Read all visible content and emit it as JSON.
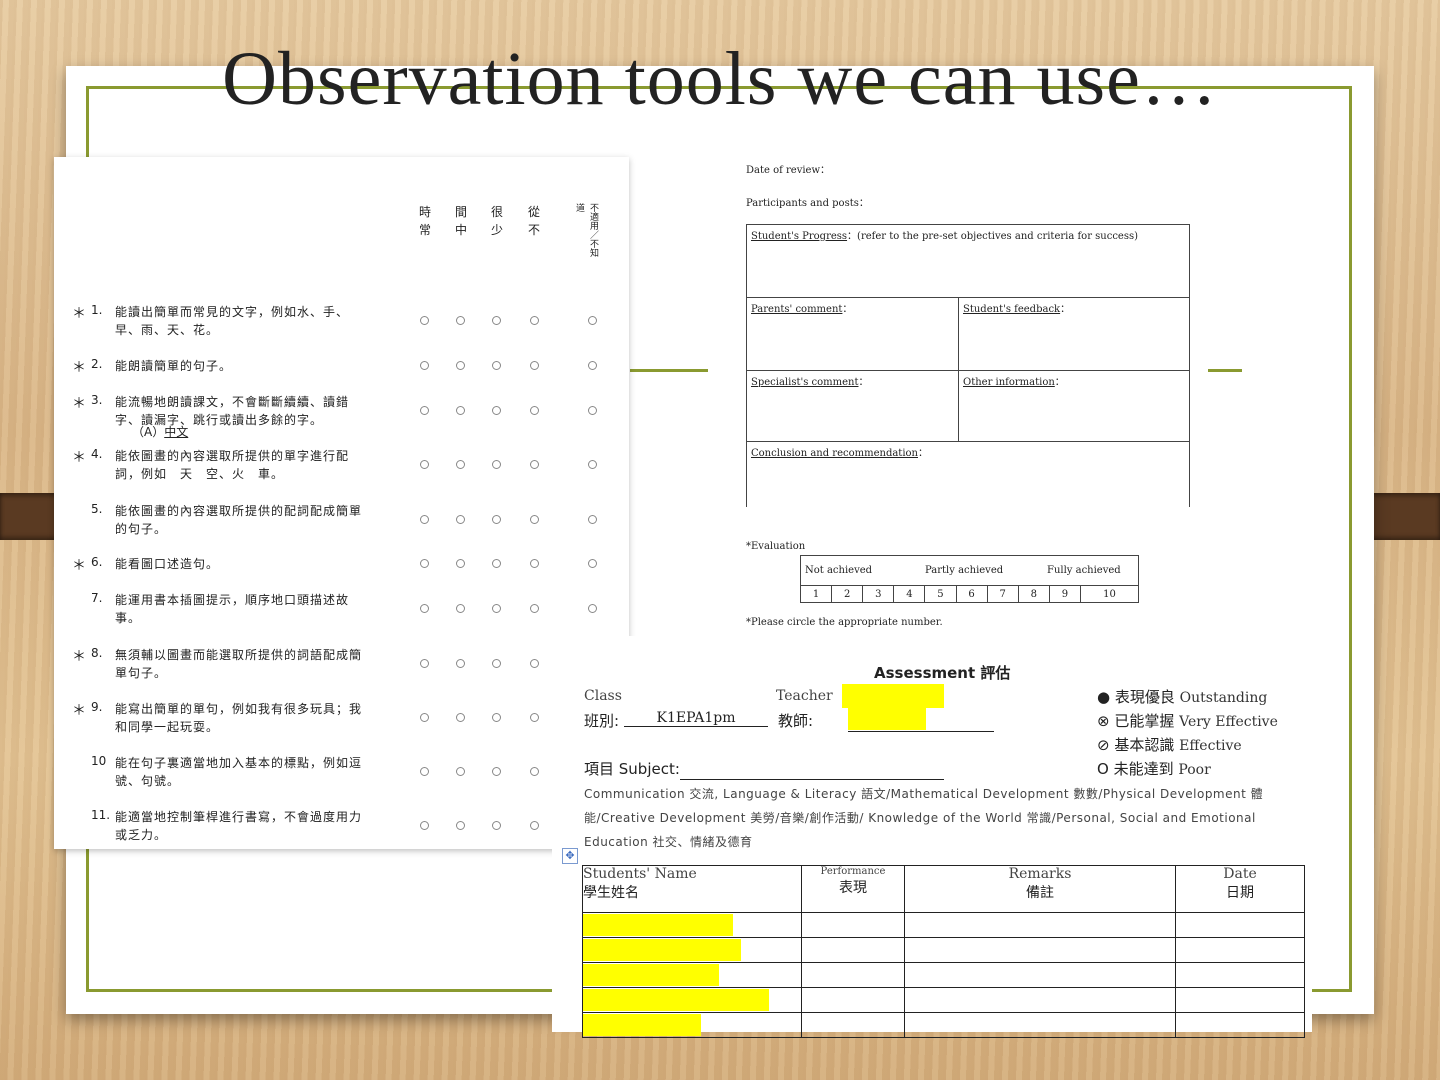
{
  "slide": {
    "title": "Observation tools we can use…"
  },
  "checklist": {
    "column_headers": [
      {
        "top": "時",
        "bottom": "常"
      },
      {
        "top": "間",
        "bottom": "中"
      },
      {
        "top": "很",
        "bottom": "少"
      },
      {
        "top": "從",
        "bottom": "不"
      }
    ],
    "na_header": "不適用／不知道",
    "section": "（A）",
    "section_name": "中文",
    "items": [
      {
        "star": "＊",
        "num": "1.",
        "text": "能讀出簡單而常見的文字，例如水、手、早、雨、天、花。"
      },
      {
        "star": "＊",
        "num": "2.",
        "text": "能朗讀簡單的句子。"
      },
      {
        "star": "＊",
        "num": "3.",
        "text": "能流暢地朗讀課文，不會斷斷續續、讀錯字、讀漏字、跳行或讀出多餘的字。"
      },
      {
        "star": "＊",
        "num": "4.",
        "text": "能依圖畫的內容選取所提供的單字進行配詞，例如　天　空、火　車。"
      },
      {
        "star": "",
        "num": "5.",
        "text": "能依圖畫的內容選取所提供的配詞配成簡單的句子。"
      },
      {
        "star": "＊",
        "num": "6.",
        "text": "能看圖口述造句。"
      },
      {
        "star": "",
        "num": "7.",
        "text": "能運用書本插圖提示，順序地口頭描述故事。"
      },
      {
        "star": "＊",
        "num": "8.",
        "text": "無須輔以圖畫而能選取所提供的詞語配成簡單句子。"
      },
      {
        "star": "＊",
        "num": "9.",
        "text": "能寫出簡單的單句，例如我有很多玩具；我和同學一起玩耍。"
      },
      {
        "star": "",
        "num": "10",
        "text": "能在句子裏適當地加入基本的標點，例如逗號、句號。"
      },
      {
        "star": "",
        "num": "11.",
        "text": "能適當地控制筆桿進行書寫，不會過度用力或乏力。"
      }
    ]
  },
  "review_form": {
    "date_label": "Date of review：",
    "participants_label": "Participants and posts：",
    "progress_label": "Student's Progress",
    "progress_note": "：(refer to the pre-set objectives and criteria for success)",
    "parents_label": "Parents' comment",
    "feedback_label": "Student's feedback",
    "specialist_label": "Specialist's comment",
    "other_label": "Other information",
    "conclusion_label": "Conclusion and recommendation",
    "colon": "：",
    "evaluation_label": "*Evaluation",
    "scale_labels": [
      "Not achieved",
      "Partly achieved",
      "Fully achieved"
    ],
    "scale_numbers": [
      "1",
      "2",
      "3",
      "4",
      "5",
      "6",
      "7",
      "8",
      "9",
      "10"
    ],
    "circle_note": "*Please circle the appropriate number."
  },
  "assessment": {
    "title": "Assessment 評估",
    "class_en": "Class",
    "class_zh": "班別:",
    "class_value": "K1EPA1pm",
    "teacher_en": "Teacher",
    "teacher_zh": "教師:",
    "subject_label": "項目 Subject:",
    "legend": [
      {
        "symbol": "●",
        "zh": "表現優良",
        "en": "Outstanding"
      },
      {
        "symbol": "⊗",
        "zh": "已能掌握",
        "en": "Very Effective"
      },
      {
        "symbol": "⊘",
        "zh": "基本認識",
        "en": "Effective"
      },
      {
        "symbol": "O",
        "zh": "未能達到",
        "en": "Poor"
      }
    ],
    "subjects_text": "Communication 交流, Language & Literacy 語文/Mathematical Development 數數/Physical Development 體能/Creative Development 美勞/音樂/創作活動/ Knowledge of the World 常識/Personal, Social and Emotional Education 社交、情緒及德育",
    "columns": [
      {
        "en": "Students' Name",
        "zh": "學生姓名"
      },
      {
        "en": "Performance",
        "zh": "表現"
      },
      {
        "en": "Remarks",
        "zh": "備註"
      },
      {
        "en": "Date",
        "zh": "日期"
      }
    ],
    "row_count_marks": [
      "",
      "",
      "",
      "",
      ""
    ]
  }
}
